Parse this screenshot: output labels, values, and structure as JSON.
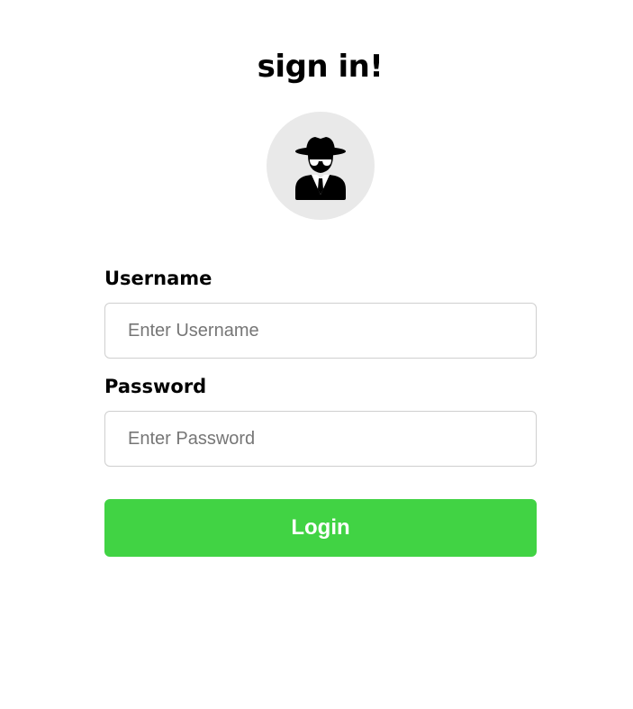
{
  "header": {
    "title": "sign in!"
  },
  "avatar": {
    "icon": "spy-icon",
    "background": "#e9e9e9"
  },
  "form": {
    "username_label": "Username",
    "username_placeholder": "Enter Username",
    "username_value": "",
    "password_label": "Password",
    "password_placeholder": "Enter Password",
    "password_value": "",
    "login_label": "Login"
  },
  "colors": {
    "accent": "#41d344",
    "border": "#cfcfcf"
  }
}
